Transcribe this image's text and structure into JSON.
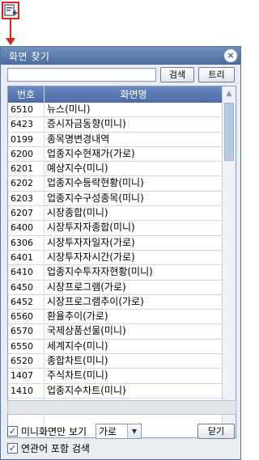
{
  "window": {
    "title": "화면 찾기",
    "close_label": "×"
  },
  "search": {
    "value": "",
    "placeholder": "",
    "search_label": "검색",
    "tree_label": "트리"
  },
  "list": {
    "headers": {
      "code": "번호",
      "name": "화면명"
    },
    "rows": [
      {
        "code": "6510",
        "name": "뉴스(미니)"
      },
      {
        "code": "6423",
        "name": "증시자금동향(미니)"
      },
      {
        "code": "0199",
        "name": "종목명변경내역"
      },
      {
        "code": "6200",
        "name": "업종지수현재가(가로)"
      },
      {
        "code": "6201",
        "name": "예상지수(미니)"
      },
      {
        "code": "6202",
        "name": "업종지수등락현황(미니)"
      },
      {
        "code": "6203",
        "name": "업종지수구성종목(미니)"
      },
      {
        "code": "6207",
        "name": "시장종합(미니)"
      },
      {
        "code": "6400",
        "name": "시장투자자종합(미니)"
      },
      {
        "code": "6306",
        "name": "시장투자자일자(가로)"
      },
      {
        "code": "6401",
        "name": "시장투자자시간(가로)"
      },
      {
        "code": "6410",
        "name": "업종지수투자자현황(미니)"
      },
      {
        "code": "6450",
        "name": "시장프로그램(가로)"
      },
      {
        "code": "6452",
        "name": "시장프로그램추이(가로)"
      },
      {
        "code": "6560",
        "name": "환율추이(가로)"
      },
      {
        "code": "6570",
        "name": "국제상품선물(미니)"
      },
      {
        "code": "6550",
        "name": "세계지수(미니)"
      },
      {
        "code": "6520",
        "name": "종합차트(미니)"
      },
      {
        "code": "1407",
        "name": "주식차트(미니)"
      },
      {
        "code": "1410",
        "name": "업종지수차트(미니)"
      }
    ]
  },
  "options": {
    "mini_only_label": "미니화면만 보기",
    "mini_only_checked": true,
    "view_mode_value": "가로",
    "include_related_label": "연관어 포함 검색",
    "include_related_checked": true,
    "close_label": "닫기",
    "check_mark": "✓"
  },
  "icons": {
    "launcher": "new-window-icon",
    "arrow": "arrow-down-icon",
    "scroll_up": "scroll-up-icon",
    "scroll_down": "scroll-down-icon",
    "dropdown": "chevron-down-icon"
  },
  "colors": {
    "title_bar": "#4c6d9c",
    "header": "#5a7bb0",
    "annotation": "#e0231c"
  }
}
